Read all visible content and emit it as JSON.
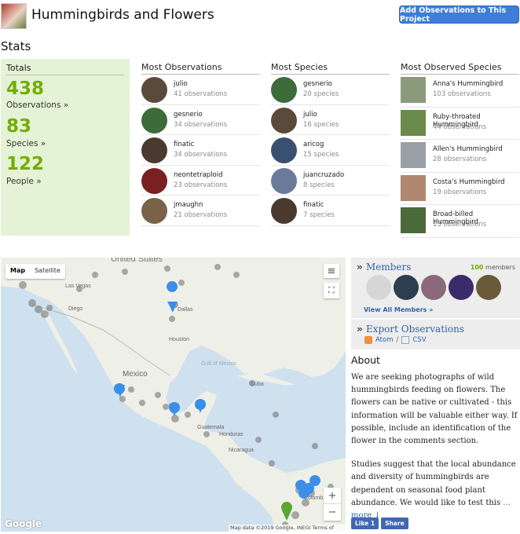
{
  "header": {
    "title": "Hummingbirds and Flowers",
    "add_button": "Add Observations to This Project"
  },
  "stats_heading": "Stats",
  "totals": {
    "label": "Totals",
    "observations_count": "438",
    "observations_label": "Observations »",
    "species_count": "83",
    "species_label": "Species »",
    "people_count": "122",
    "people_label": "People »"
  },
  "most_observations": {
    "heading": "Most Observations",
    "items": [
      {
        "name": "julio",
        "count": "41 observations",
        "color": "#5a4a3a"
      },
      {
        "name": "gesnerio",
        "count": "34 observations",
        "color": "#3d6b3a"
      },
      {
        "name": "finatic",
        "count": "34 observations",
        "color": "#4a3a30"
      },
      {
        "name": "neontetraploid",
        "count": "23 observations",
        "color": "#7a2020"
      },
      {
        "name": "jmaughn",
        "count": "21 observations",
        "color": "#7a6248"
      }
    ]
  },
  "most_species": {
    "heading": "Most Species",
    "items": [
      {
        "name": "gesnerio",
        "count": "20 species",
        "color": "#3d6b3a"
      },
      {
        "name": "julio",
        "count": "16 species",
        "color": "#5a4a3a"
      },
      {
        "name": "aricog",
        "count": "15 species",
        "color": "#3a5070"
      },
      {
        "name": "juancruzado",
        "count": "8 species",
        "color": "#6a7a9a"
      },
      {
        "name": "finatic",
        "count": "7 species",
        "color": "#4a3a30"
      }
    ]
  },
  "most_observed_species": {
    "heading": "Most Observed Species",
    "items": [
      {
        "name": "Anna's Hummingbird",
        "count": "103 observations",
        "color": "#8a9a7a"
      },
      {
        "name": "Ruby-throated Hummingbird",
        "count": "44 observations",
        "color": "#6a8a4a"
      },
      {
        "name": "Allen's Hummingbird",
        "count": "28 observations",
        "color": "#9aa0a8"
      },
      {
        "name": "Costa's Hummingbird",
        "count": "19 observations",
        "color": "#b08870"
      },
      {
        "name": "Broad-billed Hummingbird",
        "count": "13 observations",
        "color": "#4a6a3a"
      }
    ]
  },
  "map": {
    "map_label": "Map",
    "satellite_label": "Satellite",
    "google": "Google",
    "attribution": "Map data ©2019 Google, INEGI   Terms of Use",
    "zoom_in": "+",
    "zoom_out": "−",
    "place_labels": {
      "us": "United States",
      "lasvegas": "Las Vegas",
      "diego": "Diego",
      "dallas": "Dallas",
      "houston": "Houston",
      "mexico": "Mexico",
      "gulf": "Gulf of Mexico",
      "cuba": "Cuba",
      "guatemala": "Guatemala",
      "honduras": "Honduras",
      "nicaragua": "Nicaragua",
      "colombia": "Colomb"
    }
  },
  "members": {
    "title": "Members",
    "count": "100",
    "count_label": "members",
    "view_all": "View All Members »"
  },
  "export": {
    "title": "Export Observations",
    "atom": "Atom",
    "sep": "/",
    "csv": "CSV"
  },
  "about": {
    "heading": "About",
    "p1": "We are seeking photographs of wild hummingbirds feeding on flowers. The flowers can be native or cultivated - this information will be valuable either way. If possible, include an identification of the flower in the comments section.",
    "p2": "Studies suggest that the local abundance and diversity of hummingbirds are dependent on seasonal food plant abundance. We would like to test this",
    "more": "…more ↓"
  },
  "facebook": {
    "like": "Like 1",
    "share": "Share"
  }
}
